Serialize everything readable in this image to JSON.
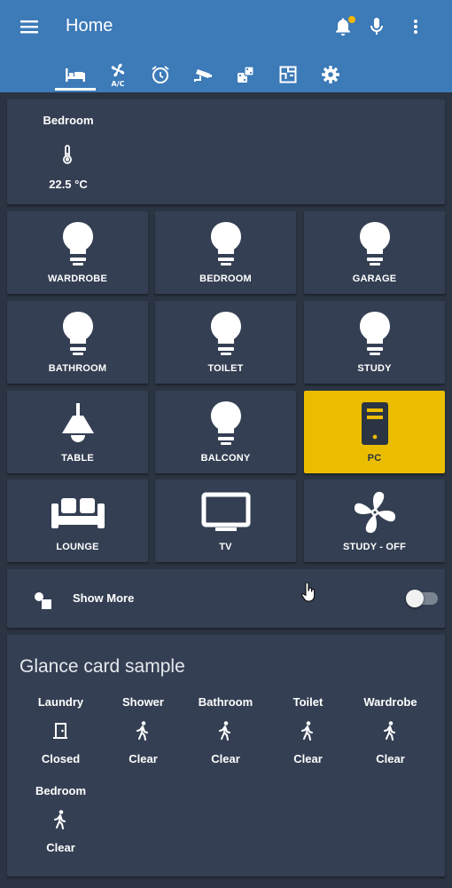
{
  "header": {
    "title": "Home",
    "menu_icon": "menu-icon",
    "notifications_icon": "bell-icon",
    "mic_icon": "microphone-icon",
    "more_icon": "more-vertical-icon",
    "accent": "#3d7ab8",
    "badge_color": "#f2b705"
  },
  "tabs": [
    {
      "icon": "bed-icon",
      "selected": true
    },
    {
      "icon": "fan-ac-icon",
      "text": "A/C",
      "selected": false
    },
    {
      "icon": "alarm-clock-icon",
      "selected": false
    },
    {
      "icon": "cctv-camera-icon",
      "selected": false
    },
    {
      "icon": "dice-icon",
      "selected": false
    },
    {
      "icon": "floor-plan-icon",
      "selected": false
    },
    {
      "icon": "gear-icon",
      "selected": false
    }
  ],
  "sensor": {
    "name": "Bedroom",
    "icon": "thermometer-icon",
    "value": "22.5 °C"
  },
  "buttons": [
    {
      "label": "WARDROBE",
      "icon": "lightbulb-icon",
      "active": false
    },
    {
      "label": "BEDROOM",
      "icon": "lightbulb-icon",
      "active": false
    },
    {
      "label": "GARAGE",
      "icon": "lightbulb-icon",
      "active": false
    },
    {
      "label": "BATHROOM",
      "icon": "lightbulb-icon",
      "active": false
    },
    {
      "label": "TOILET",
      "icon": "lightbulb-icon",
      "active": false
    },
    {
      "label": "STUDY",
      "icon": "lightbulb-icon",
      "active": false
    },
    {
      "label": "TABLE",
      "icon": "ceiling-lamp-icon",
      "active": false
    },
    {
      "label": "BALCONY",
      "icon": "lightbulb-icon",
      "active": false
    },
    {
      "label": "PC",
      "icon": "desktop-tower-icon",
      "active": true
    },
    {
      "label": "LOUNGE",
      "icon": "sofa-icon",
      "active": false
    },
    {
      "label": "TV",
      "icon": "television-icon",
      "active": false
    },
    {
      "label": "STUDY - OFF",
      "icon": "fan-icon",
      "active": false
    }
  ],
  "active_color": "#ebbd00",
  "show_more": {
    "label": "Show More",
    "icon": "shapes-icon",
    "toggle_on": false
  },
  "glance": {
    "title": "Glance card sample",
    "items": [
      {
        "name": "Laundry",
        "icon": "door-closed-icon",
        "state": "Closed"
      },
      {
        "name": "Shower",
        "icon": "walk-icon",
        "state": "Clear"
      },
      {
        "name": "Bathroom",
        "icon": "walk-icon",
        "state": "Clear"
      },
      {
        "name": "Toilet",
        "icon": "walk-icon",
        "state": "Clear"
      },
      {
        "name": "Wardrobe",
        "icon": "walk-icon",
        "state": "Clear"
      },
      {
        "name": "Bedroom",
        "icon": "walk-icon",
        "state": "Clear"
      }
    ]
  }
}
